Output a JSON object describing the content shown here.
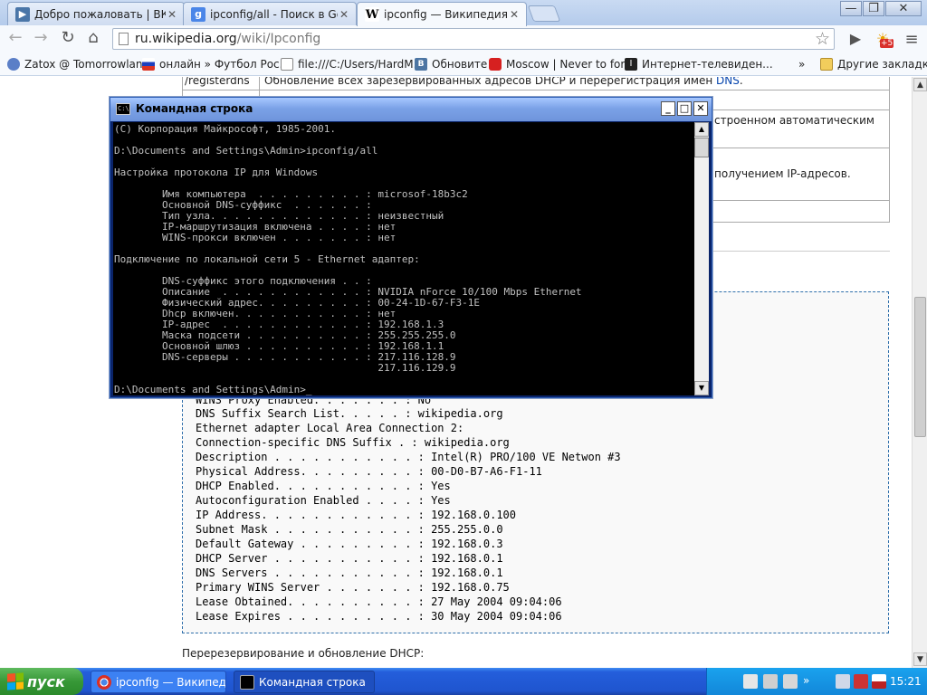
{
  "browser": {
    "tabs": [
      {
        "title": "Добро пожаловать | ВКонт",
        "icon": "vk-icon",
        "active": false
      },
      {
        "title": "ipconfig/all - Поиск в Google",
        "icon": "google-icon",
        "active": false
      },
      {
        "title": "ipconfig — Википедия",
        "icon": "wikipedia-icon",
        "active": true
      }
    ],
    "tab_close": "✕",
    "window_controls": {
      "minimize": "—",
      "maximize": "❐",
      "close": "✕"
    },
    "url_host": "ru.wikipedia.org",
    "url_path": "/wiki/Ipconfig",
    "extension_badge": "+5",
    "bookmarks": [
      {
        "label": "Zatox @ Tomorrowlan..."
      },
      {
        "label": "онлайн » Футбол Рос..."
      },
      {
        "label": "file:///C:/Users/HardM..."
      },
      {
        "label": "Обновите"
      },
      {
        "label": "Moscow | Never to for..."
      },
      {
        "label": "Интернет-телевиден..."
      }
    ],
    "bookmarks_more": "»",
    "other_bookmarks": "Другие закладки"
  },
  "page": {
    "table_rows": [
      {
        "cmd": "/registerdns",
        "desc_prefix": "Обновление всех зарезервированных адресов DHCP и перерегистрация имен ",
        "desc_link": "DNS",
        "desc_suffix": "."
      },
      {
        "cmd": "",
        "desc": "строенном автоматическим"
      },
      {
        "cmd": "",
        "desc": "получением IP-адресов."
      }
    ],
    "pre_lines": [
      "WINS Proxy Enabled. . . . . . . : No",
      "DNS Suffix Search List. . . . . : wikipedia.org",
      "Ethernet adapter Local Area Connection 2:",
      "Connection-specific DNS Suffix . : wikipedia.org",
      "Description . . . . . . . . . . . : Intel(R) PRO/100 VE Netwon #3",
      "Physical Address. . . . . . . . . : 00-D0-B7-A6-F1-11",
      "DHCP Enabled. . . . . . . . . . . : Yes",
      "Autoconfiguration Enabled . . . . : Yes",
      "IP Address. . . . . . . . . . . . : 192.168.0.100",
      "Subnet Mask . . . . . . . . . . . : 255.255.0.0",
      "Default Gateway . . . . . . . . . : 192.168.0.3",
      "DHCP Server . . . . . . . . . . . : 192.168.0.1",
      "DNS Servers . . . . . . . . . . . : 192.168.0.1",
      "Primary WINS Server . . . . . . . : 192.168.0.75",
      "Lease Obtained. . . . . . . . . . : 27 May 2004 09:04:06",
      "Lease Expires . . . . . . . . . . : 30 May 2004 09:04:06"
    ],
    "after_text": "Перерезервирование и обновление DHCP:"
  },
  "cmd_window": {
    "title": "Командная строка",
    "icon_text": "C:\\",
    "buttons": {
      "minimize": "_",
      "maximize": "□",
      "close": "✕"
    },
    "lines": [
      "(C) Корпорация Майкрософт, 1985-2001.",
      "",
      "D:\\Documents and Settings\\Admin>ipconfig/all",
      "",
      "Настройка протокола IP для Windows",
      "",
      "        Имя компьютера  . . . . . . . . . : microsof-18b3c2",
      "        Основной DNS-суффикс  . . . . . . :",
      "        Тип узла. . . . . . . . . . . . . : неизвестный",
      "        IP-маршрутизация включена . . . . : нет",
      "        WINS-прокси включен . . . . . . . : нет",
      "",
      "Подключение по локальной сети 5 - Ethernet адаптер:",
      "",
      "        DNS-суффикс этого подключения . . :",
      "        Описание  . . . . . . . . . . . . : NVIDIA nForce 10/100 Mbps Ethernet",
      "        Физический адрес. . . . . . . . . : 00-24-1D-67-F3-1E",
      "        Dhcp включен. . . . . . . . . . . : нет",
      "        IP-адрес  . . . . . . . . . . . . : 192.168.1.3",
      "        Маска подсети . . . . . . . . . . : 255.255.255.0",
      "        Основной шлюз . . . . . . . . . . : 192.168.1.1",
      "        DNS-серверы . . . . . . . . . . . : 217.116.128.9",
      "                                            217.116.129.9",
      "",
      "D:\\Documents and Settings\\Admin>_"
    ]
  },
  "taskbar": {
    "start_label": "пуск",
    "tasks": [
      {
        "label": "ipconfig — Википеди...",
        "active": false
      },
      {
        "label": "Командная строка",
        "active": true
      }
    ],
    "language": "EN",
    "clock": "15:21"
  },
  "colors": {
    "wiki_link": "#0645ad",
    "xp_taskbar": "#245edb",
    "xp_start": "#379837",
    "console_bg": "#000000",
    "console_fg": "#c0c0c0"
  }
}
